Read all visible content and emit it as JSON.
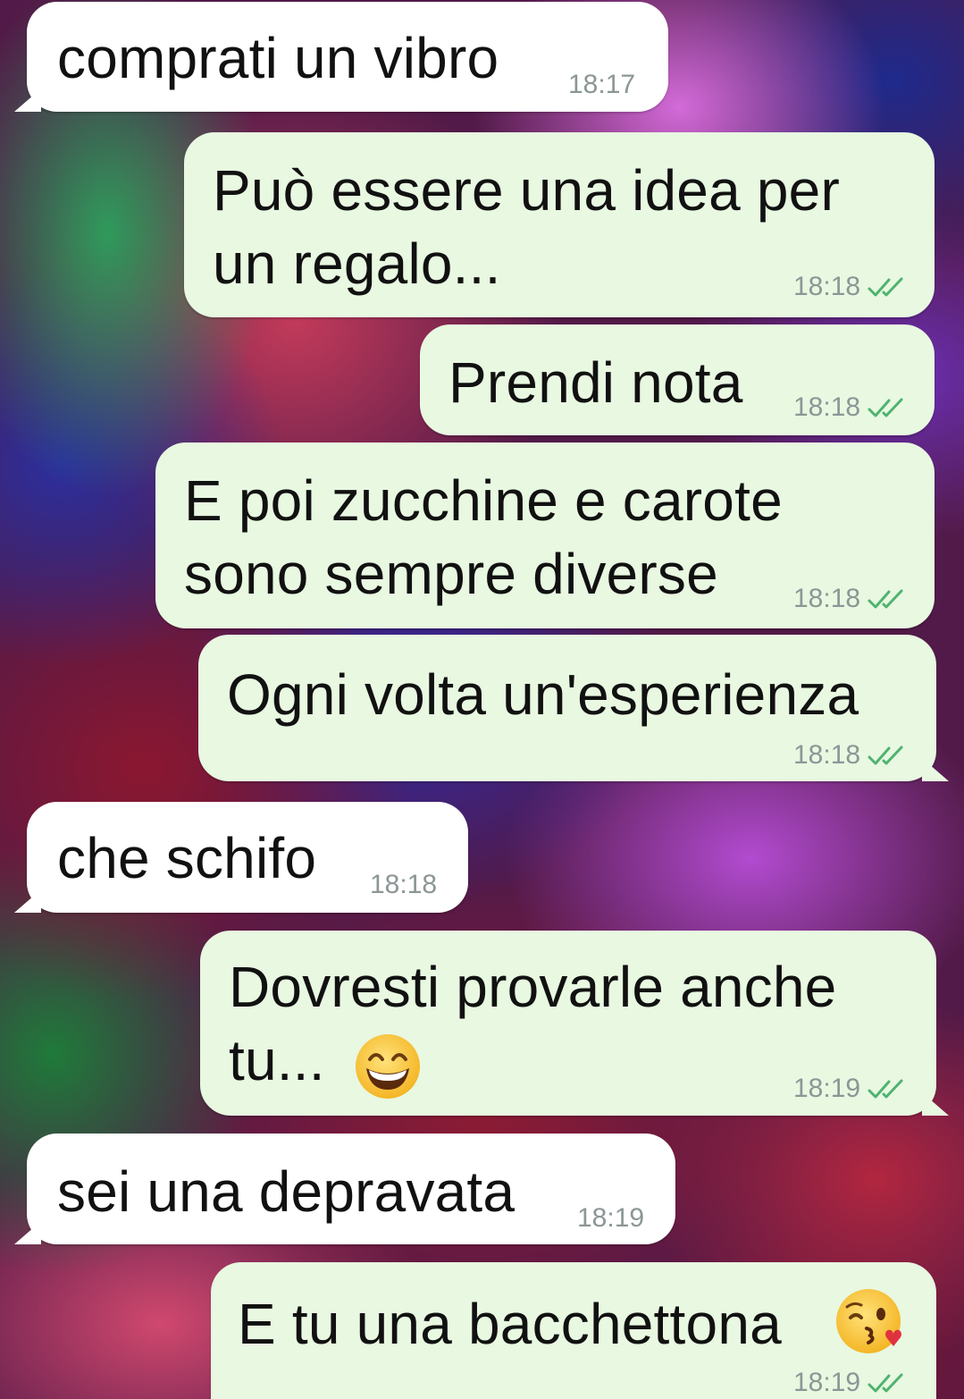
{
  "wallpaper": "colorful-floral-wallpaper",
  "colors": {
    "incoming_bubble": "#ffffff",
    "outgoing_bubble": "#e8f8e1",
    "timestamp": "#8c9696",
    "read_ticks": "#4fb36f"
  },
  "messages": [
    {
      "direction": "in",
      "text": "comprati un vibro",
      "time": "18:17"
    },
    {
      "direction": "out",
      "line1": "Può essere una idea per",
      "line2": "un regalo...",
      "time": "18:18",
      "status": "read"
    },
    {
      "direction": "out",
      "text": "Prendi nota",
      "time": "18:18",
      "status": "read"
    },
    {
      "direction": "out",
      "line1": "E poi zucchine e carote",
      "line2": "sono sempre diverse",
      "time": "18:18",
      "status": "read"
    },
    {
      "direction": "out",
      "text": "Ogni volta un'esperienza",
      "time": "18:18",
      "status": "read"
    },
    {
      "direction": "in",
      "text": "che schifo",
      "time": "18:18"
    },
    {
      "direction": "out",
      "line1": "Dovresti provarle anche",
      "line2": "tu... ",
      "emoji": "grinning-face-emoji",
      "time": "18:19",
      "status": "read"
    },
    {
      "direction": "in",
      "text": "sei una depravata",
      "time": "18:19"
    },
    {
      "direction": "out",
      "text": "E tu una bacchettona",
      "emoji": "face-blowing-kiss-emoji",
      "time": "18:19",
      "status": "read"
    }
  ]
}
